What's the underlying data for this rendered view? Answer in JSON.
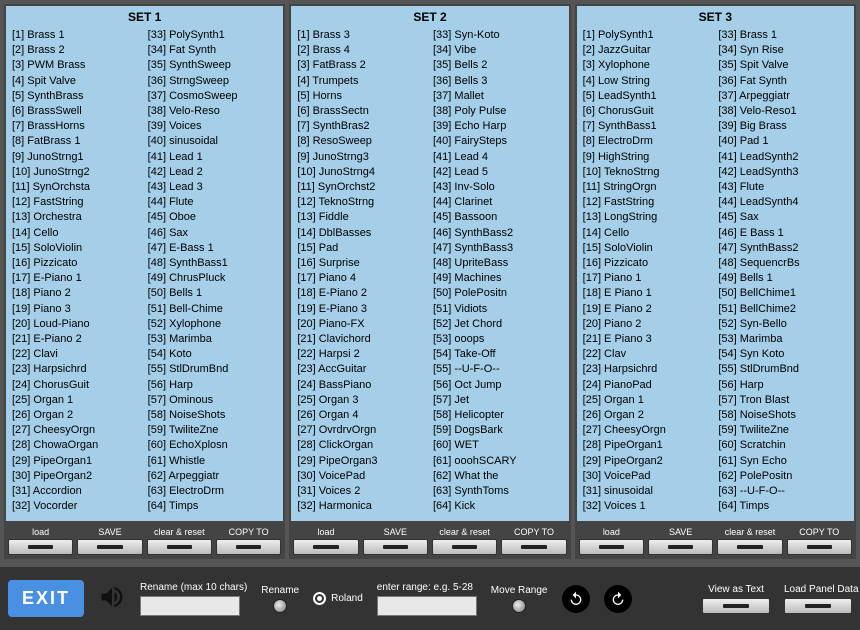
{
  "sets": [
    {
      "title": "SET 1",
      "patches": [
        "Brass 1",
        "Brass 2",
        "PWM Brass",
        "Spit Valve",
        "SynthBrass",
        "BrassSwell",
        "BrassHorns",
        "FatBrass 1",
        "JunoStrng1",
        "JunoStrng2",
        "SynOrchsta",
        "FastString",
        "Orchestra",
        "Cello",
        "SoloViolin",
        "Pizzicato",
        "E-Piano 1",
        "Piano 2",
        "Piano 3",
        "Loud-Piano",
        "E-Piano 2",
        "Clavi",
        "Harpsichrd",
        "ChorusGuit",
        "Organ 1",
        "Organ 2",
        "CheesyOrgn",
        "ChowaOrgan",
        "PipeOrgan1",
        "PipeOrgan2",
        "Accordion",
        "Vocorder",
        "PolySynth1",
        "Fat Synth",
        "SynthSweep",
        "StrngSweep",
        "CosmoSweep",
        "Velo-Reso",
        " Voices",
        "sinusoidal",
        "Lead 1",
        "Lead 2",
        "Lead 3",
        "Flute",
        "Oboe",
        "Sax",
        "E-Bass 1",
        "SynthBass1",
        "ChrusPluck",
        "Bells 1",
        "Bell-Chime",
        "Xylophone",
        "Marimba",
        "Koto",
        "StlDrumBnd",
        "Harp",
        "Ominous",
        "NoiseShots",
        "TwiliteZne",
        "EchoXplosn",
        "Whistle",
        "Arpeggiatr",
        "ElectroDrm",
        "Timps"
      ]
    },
    {
      "title": "SET 2",
      "patches": [
        "Brass 3",
        "Brass 4",
        "FatBrass 2",
        "Trumpets",
        "Horns",
        "BrassSectn",
        "SynthBras2",
        "ResoSweep",
        "JunoStrng3",
        "JunoStrng4",
        "SynOrchst2",
        "TeknoStrng",
        "Fiddle",
        "DblBasses",
        "Pad",
        "Surprise",
        "Piano 4",
        "E-Piano 2",
        "E-Piano 3",
        "Piano-FX",
        "Clavichord",
        "Harpsi 2",
        "AccGuitar",
        "BassPiano",
        "Organ 3",
        "Organ 4",
        "OvrdrvOrgn",
        "ClickOrgan",
        "PipeOrgan3",
        "VoicePad",
        "Voices 2",
        "Harmonica",
        "Syn-Koto",
        "Vibe",
        "Bells 2",
        "Bells 3",
        "Mallet",
        "Poly Pulse",
        "Echo Harp",
        "FairySteps",
        "Lead 4",
        "Lead 5",
        "Inv-Solo",
        "Clarinet",
        "Bassoon",
        "SynthBass2",
        "SynthBass3",
        "UpriteBass",
        "Machines",
        "PolePositn",
        "Vidiots",
        "Jet Chord",
        "ooops",
        "Take-Off",
        "--U-F-O--",
        "Oct Jump",
        "Jet",
        "Helicopter",
        "DogsBark",
        "WET",
        "ooohSCARY",
        "What the",
        "SynthToms",
        "Kick"
      ]
    },
    {
      "title": "SET 3",
      "patches": [
        "PolySynth1",
        "JazzGuitar",
        "Xylophone",
        "Low String",
        "LeadSynth1",
        "ChorusGuit",
        "SynthBass1",
        "ElectroDrm",
        "HighString",
        "TeknoStrng",
        "StringOrgn",
        "FastString",
        "LongString",
        "Cello",
        "SoloViolin",
        "Pizzicato",
        "Piano 1",
        "E Piano 1",
        "E Piano 2",
        "Piano 2",
        "E Piano 3",
        "Clav",
        "Harpsichrd",
        "PianoPad",
        "Organ 1",
        "Organ 2",
        "CheesyOrgn",
        "PipeOrgan1",
        "PipeOrgan2",
        "VoicePad",
        "sinusoidal",
        " Voices 1",
        "Brass 1",
        "Syn Rise",
        "Spit Valve",
        "Fat Synth",
        "Arpeggiatr",
        "Velo-Reso1",
        "Big Brass",
        "Pad 1",
        "LeadSynth2",
        "LeadSynth3",
        "Flute",
        "LeadSynth4",
        "Sax",
        "E Bass 1",
        "SynthBass2",
        "SequencrBs",
        "Bells 1",
        "BellChime1",
        "BellChime2",
        "Syn-Bello",
        "Marimba",
        "Syn Koto",
        "StlDrumBnd",
        "Harp",
        "Tron Blast",
        "NoiseShots",
        "TwiliteZne",
        "Scratchin",
        "Syn Echo",
        "PolePositn",
        "--U-F-O--",
        "Timps"
      ]
    }
  ],
  "setButtons": [
    "load",
    "SAVE",
    "clear & reset",
    "COPY TO"
  ],
  "bottom": {
    "exit": "EXIT",
    "rename_label": "Rename (max 10 chars)",
    "rename_btn": "Rename",
    "roland": "Roland",
    "range_label": "enter range: e.g. 5-28",
    "move_range": "Move Range",
    "view_as_text": "View as Text",
    "load_panel": "Load Panel Data"
  }
}
